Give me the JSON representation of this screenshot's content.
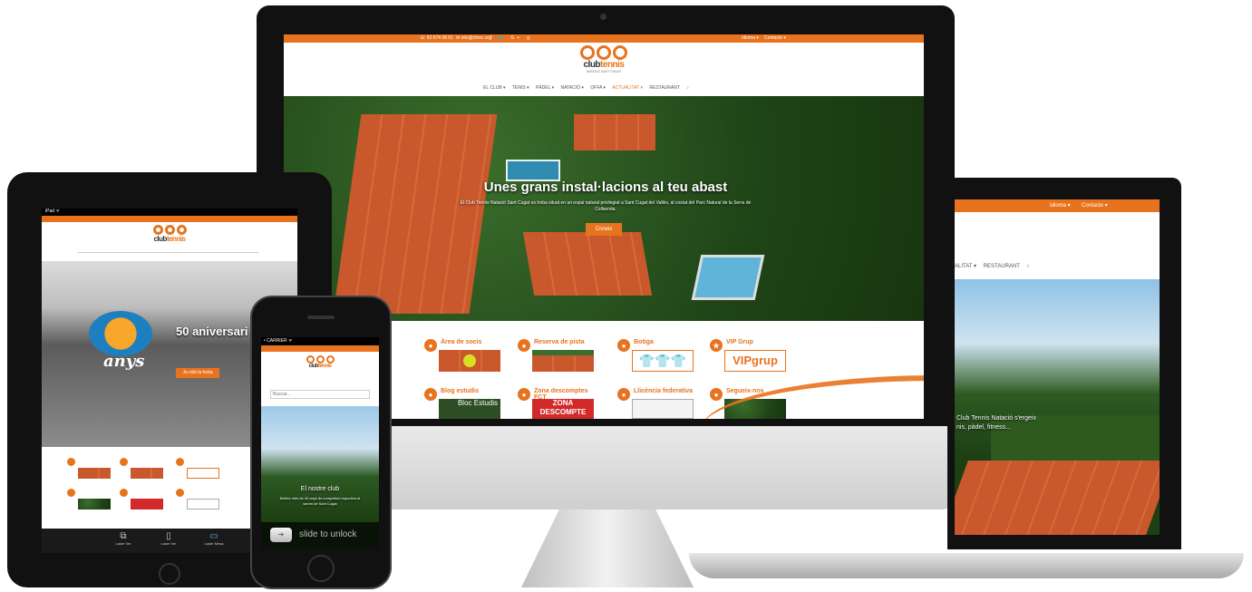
{
  "imac": {
    "topbar": {
      "phone": "☏ 93 674 08 51",
      "email": "✉ info@ctnsc.org",
      "social_icons": [
        "facebook-icon",
        "twitter-icon",
        "googleplus-icon",
        "instagram-icon"
      ],
      "right_links": [
        "Idioma ▾",
        "Contacte ▾"
      ]
    },
    "logo": {
      "word1": "club",
      "word2": "tennis",
      "subtitle": "NATACIÓ SANT CUGAT"
    },
    "nav": [
      "EL CLUB ▾",
      "TENIS ▾",
      "PÀDEL ▾",
      "NATACIÓ ▾",
      "OFFA ▾",
      "ACTUALITAT ▾",
      "RESTAURANT"
    ],
    "hero": {
      "title": "Unes grans instal·lacions al teu abast",
      "text": "El Club Tennis Natació Sant Cugat es troba situat en un espai natural privilegiat a Sant Cugat del Vallès, al costat del Parc Natural de la Serra de Collserola.",
      "button": "Coneix"
    },
    "tiles": [
      {
        "label": "Àrea de socis",
        "icon": "tennis-ball-icon"
      },
      {
        "label": "Reserva de pista",
        "icon": "calendar-icon"
      },
      {
        "label": "Botiga",
        "icon": "shop-icon"
      },
      {
        "label": "VIP Grup",
        "icon": "star-icon",
        "brand": "VIPgrup"
      },
      {
        "label": "Blog estudis",
        "icon": "blog-icon",
        "thumb_text": "Bloc Estudis"
      },
      {
        "label": "Zona descomptes FCT",
        "icon": "discount-icon",
        "thumb_text": "ZONA DESCOMPTE"
      },
      {
        "label": "Llicència federativa",
        "icon": "license-icon"
      },
      {
        "label": "Segueix-nos",
        "icon": "follow-icon"
      }
    ]
  },
  "laptop": {
    "topbar_links": [
      "Idioma ▾",
      "Contacte ▾"
    ],
    "nav": [
      "ALITAT ▾",
      "RESTAURANT"
    ],
    "hero_text_line1": "Club Tennis Natació s'ergeix",
    "hero_text_line2": "nis, pàdel, fitness..."
  },
  "tablet": {
    "status": "iPad ᯤ",
    "hero_title": "50 aniversari",
    "hero_logo_text": "anys",
    "hero_button": "Ja vols la festa",
    "dock": [
      {
        "label": "Laser Ver"
      },
      {
        "label": "Laser Ver"
      },
      {
        "label": "Laser Mesa"
      }
    ]
  },
  "phone": {
    "status_left": "• CARRIER ᯤ",
    "logo_word1": "club",
    "logo_word2": "tennis",
    "search_placeholder": "Buscar...",
    "hero_title": "El nostre club",
    "hero_text": "Moltes més de 40 anys de competició esportiva al servei de Sant Cugat",
    "unlock": "slide to unlock"
  },
  "colors": {
    "brand_orange": "#e8731f",
    "device_black": "#111111",
    "aluminium": "#d9d9d9"
  }
}
